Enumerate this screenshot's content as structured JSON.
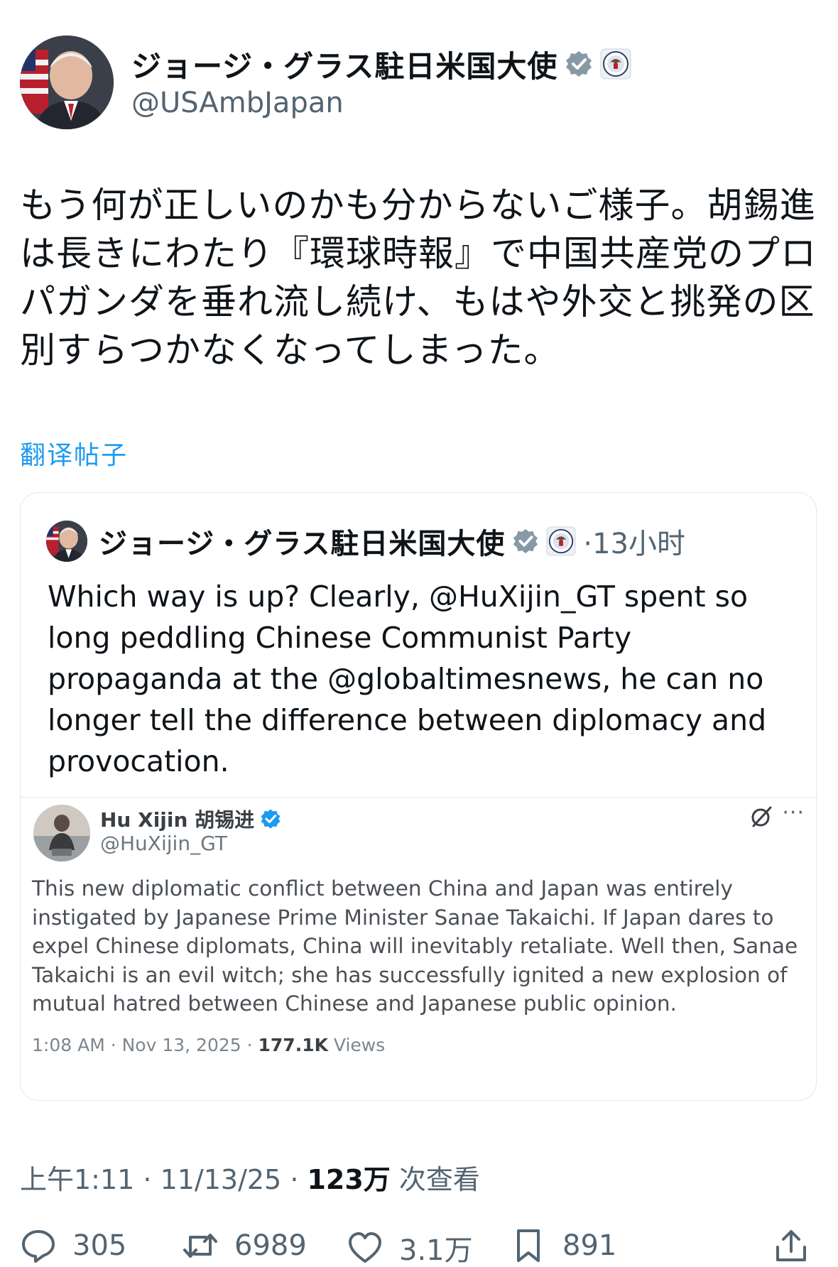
{
  "author": {
    "display_name": "ジョージ・グラス駐日米国大使",
    "handle": "@USAmbJapan"
  },
  "post": {
    "text_lines": [
      "もう何が正しいのかも分からないご様子。胡錫進",
      "は長きにわたり『環球時報』で中国共産党のプロ",
      "パガンダを垂れ流し続け、もはや外交と挑発の区",
      "別すらつかなくなってしまった。"
    ],
    "translate_label": "翻译帖子"
  },
  "quote": {
    "display_name": "ジョージ・グラス駐日米国大使",
    "time": "·13小时",
    "text_lines": [
      "Which way is up? Clearly, @HuXijin_GT spent so",
      "long peddling Chinese Communist Party",
      "propaganda at the @globaltimesnews, he can no",
      "longer tell the difference between diplomacy and",
      "provocation."
    ]
  },
  "embedded": {
    "name": "Hu Xijin 胡锡进",
    "handle": "@HuXijin_GT",
    "more": "···",
    "text_lines": [
      "This new diplomatic conflict between China and Japan was entirely",
      "instigated by Japanese Prime Minister Sanae Takaichi. If Japan dares to",
      "expel Chinese diplomats, China will inevitably retaliate. Well then, Sanae",
      "Takaichi is an evil witch; she has successfully ignited a new explosion of",
      "mutual hatred between Chinese and Japanese public opinion."
    ],
    "timestamp": "1:08 AM · Nov 13, 2025 · ",
    "views_count": "177.1K",
    "views_label": " Views"
  },
  "meta": {
    "timestamp": "上午1:11 · 11/13/25 · ",
    "views_count": "123万",
    "views_label": " 次查看"
  },
  "actions": {
    "replies": "305",
    "reposts": "6989",
    "likes": "3.1万",
    "bookmarks": "891"
  },
  "colors": {
    "link": "#1d9bf0",
    "verified": "#8899a6",
    "secondary_text": "#536471"
  }
}
